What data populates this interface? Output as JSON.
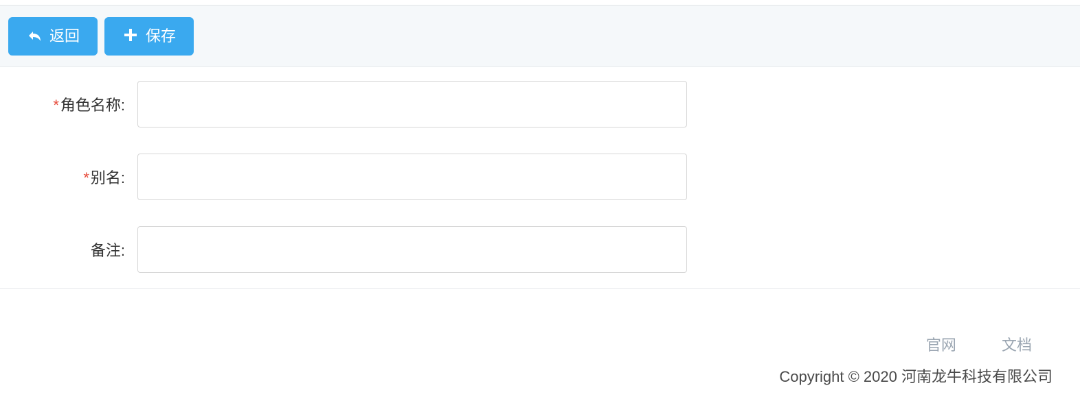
{
  "toolbar": {
    "back_label": "返回",
    "save_label": "保存"
  },
  "form": {
    "fields": [
      {
        "label": "角色名称:",
        "required": true,
        "value": ""
      },
      {
        "label": "别名:",
        "required": true,
        "value": ""
      },
      {
        "label": "备注:",
        "required": false,
        "value": ""
      }
    ]
  },
  "footer": {
    "links": [
      {
        "label": "官网"
      },
      {
        "label": "文档"
      }
    ],
    "copyright": "Copyright © 2020 河南龙牛科技有限公司"
  }
}
